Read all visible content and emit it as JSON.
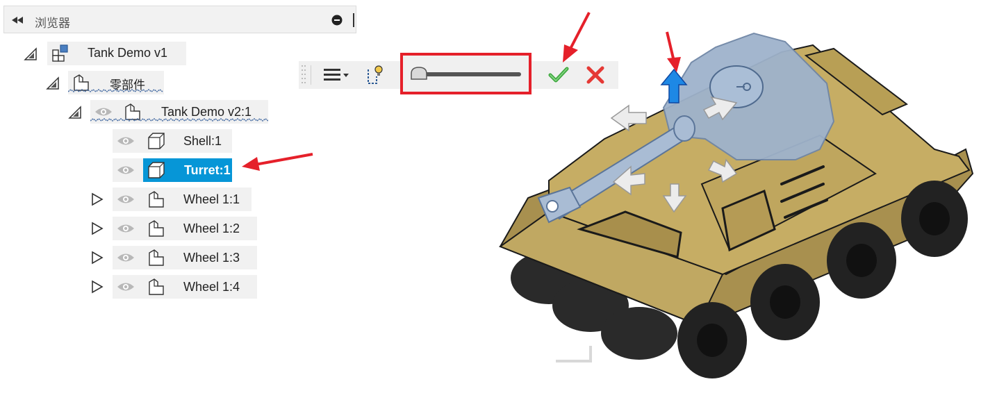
{
  "browser": {
    "title": "浏览器",
    "collapse_icon": "double-left-arrow-icon",
    "minimize_icon": "minus-circle-icon"
  },
  "tree": {
    "root": {
      "label": "Tank Demo v1",
      "icon": "design-component-icon"
    },
    "components_folder": {
      "label": "零部件",
      "icon": "component-folder-icon"
    },
    "sub_assembly": {
      "label": "Tank Demo v2:1",
      "icon": "component-icon",
      "visible": true
    },
    "children": [
      {
        "label": "Shell:1",
        "icon": "body-icon",
        "expandable": false,
        "selected": false
      },
      {
        "label": "Turret:1",
        "icon": "body-icon",
        "expandable": false,
        "selected": true
      },
      {
        "label": "Wheel 1:1",
        "icon": "component-icon",
        "expandable": true,
        "selected": false
      },
      {
        "label": "Wheel 1:2",
        "icon": "component-icon",
        "expandable": true,
        "selected": false
      },
      {
        "label": "Wheel 1:3",
        "icon": "component-icon",
        "expandable": true,
        "selected": false
      },
      {
        "label": "Wheel 1:4",
        "icon": "component-icon",
        "expandable": true,
        "selected": false
      }
    ]
  },
  "toolbar": {
    "menu_icon": "list-menu-icon",
    "pivot_icon": "set-pivot-icon",
    "slider_value": 0,
    "ok_icon": "green-check-icon",
    "cancel_icon": "red-x-icon"
  },
  "viewport": {
    "model": "tank-3d-model",
    "body_color": "#b9a05a",
    "selection_color": "#9fb3cc",
    "manipulator_up_color": "#1e88e5"
  },
  "annotations": {
    "arrow_color": "#e5202a",
    "highlight_box_color": "#e5202a"
  }
}
